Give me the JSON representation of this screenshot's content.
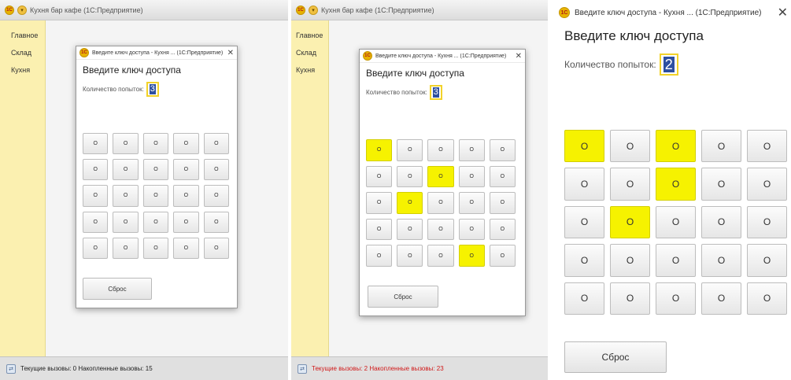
{
  "colors": {
    "sidebar": "#fbf0b0",
    "highlight": "#f6f200",
    "attempts_border": "#f2d22a",
    "attempts_bg": "#2d4fa0",
    "status_red": "#d01919"
  },
  "logo_text": "1С",
  "panel1": {
    "app_title": "Кухня бар кафе  (1С:Предприятие)",
    "sidebar": [
      "Главное",
      "Склад",
      "Кухня"
    ],
    "status": "Текущие вызовы: 0  Накопленные вызовы: 15",
    "dialog": {
      "title": "Введите ключ доступа - Кухня ...  (1С:Предприятие)",
      "heading": "Введите ключ доступа",
      "attempts_label": "Количество попыток:",
      "attempts_value": "3",
      "cell_label": "О",
      "highlighted": [],
      "reset_label": "Сброс"
    }
  },
  "panel2": {
    "app_title": "Кухня бар кафе  (1С:Предприятие)",
    "sidebar": [
      "Главное",
      "Склад",
      "Кухня"
    ],
    "status": "Текущие вызовы: 2  Накопленные вызовы: 23",
    "dialog": {
      "title": "Введите ключ доступа - Кухня ...  (1С:Предприятие)",
      "heading": "Введите ключ доступа",
      "attempts_label": "Количество попыток:",
      "attempts_value": "3",
      "cell_label": "О",
      "highlighted": [
        0,
        7,
        11,
        23
      ],
      "reset_label": "Сброс"
    }
  },
  "panel3": {
    "dialog": {
      "title": "Введите ключ доступа - Кухня ...  (1С:Предприятие)",
      "heading": "Введите ключ доступа",
      "attempts_label": "Количество попыток:",
      "attempts_value": "2",
      "cell_label": "О",
      "highlighted": [
        0,
        2,
        7,
        11
      ],
      "reset_label": "Сброс"
    }
  }
}
